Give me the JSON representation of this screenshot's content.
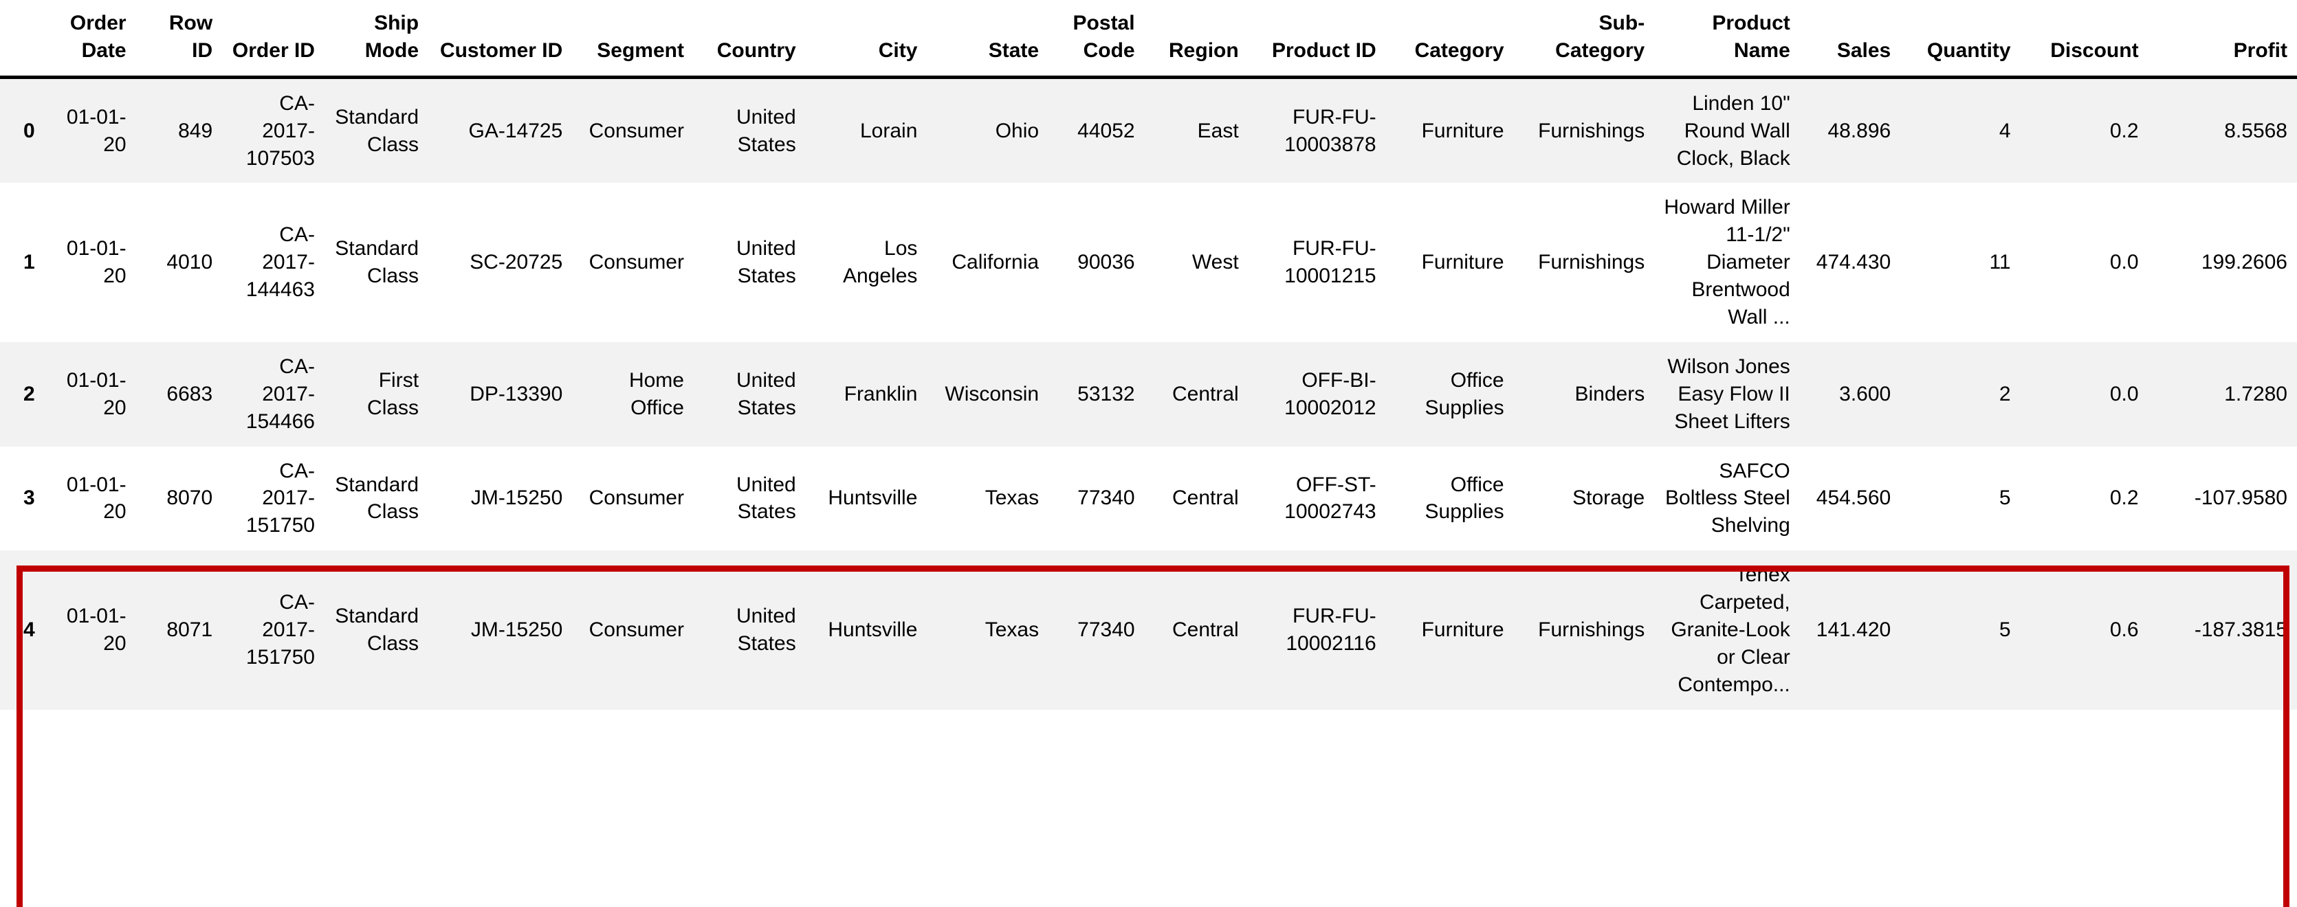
{
  "table": {
    "index_header": "",
    "columns": [
      "Order Date",
      "Row ID",
      "Order ID",
      "Ship Mode",
      "Customer ID",
      "Segment",
      "Country",
      "City",
      "State",
      "Postal Code",
      "Region",
      "Product ID",
      "Category",
      "Sub-Category",
      "Product Name",
      "Sales",
      "Quantity",
      "Discount",
      "Profit"
    ],
    "rows": [
      {
        "index": "0",
        "cells": [
          "01-01-20",
          "849",
          "CA-2017-107503",
          "Standard Class",
          "GA-14725",
          "Consumer",
          "United States",
          "Lorain",
          "Ohio",
          "44052",
          "East",
          "FUR-FU-10003878",
          "Furniture",
          "Furnishings",
          "Linden 10\" Round Wall Clock, Black",
          "48.896",
          "4",
          "0.2",
          "8.5568"
        ]
      },
      {
        "index": "1",
        "cells": [
          "01-01-20",
          "4010",
          "CA-2017-144463",
          "Standard Class",
          "SC-20725",
          "Consumer",
          "United States",
          "Los Angeles",
          "California",
          "90036",
          "West",
          "FUR-FU-10001215",
          "Furniture",
          "Furnishings",
          "Howard Miller 11-1/2\" Diameter Brentwood Wall ...",
          "474.430",
          "11",
          "0.0",
          "199.2606"
        ]
      },
      {
        "index": "2",
        "cells": [
          "01-01-20",
          "6683",
          "CA-2017-154466",
          "First Class",
          "DP-13390",
          "Home Office",
          "United States",
          "Franklin",
          "Wisconsin",
          "53132",
          "Central",
          "OFF-BI-10002012",
          "Office Supplies",
          "Binders",
          "Wilson Jones Easy Flow II Sheet Lifters",
          "3.600",
          "2",
          "0.0",
          "1.7280"
        ]
      },
      {
        "index": "3",
        "cells": [
          "01-01-20",
          "8070",
          "CA-2017-151750",
          "Standard Class",
          "JM-15250",
          "Consumer",
          "United States",
          "Huntsville",
          "Texas",
          "77340",
          "Central",
          "OFF-ST-10002743",
          "Office Supplies",
          "Storage",
          "SAFCO Boltless Steel Shelving",
          "454.560",
          "5",
          "0.2",
          "-107.9580"
        ]
      },
      {
        "index": "4",
        "cells": [
          "01-01-20",
          "8071",
          "CA-2017-151750",
          "Standard Class",
          "JM-15250",
          "Consumer",
          "United States",
          "Huntsville",
          "Texas",
          "77340",
          "Central",
          "FUR-FU-10002116",
          "Furniture",
          "Furnishings",
          "Tenex Carpeted, Granite-Look or Clear Contempo...",
          "141.420",
          "5",
          "0.6",
          "-187.3815"
        ]
      }
    ]
  },
  "annotation": {
    "highlight_color": "#c00000",
    "highlighted_row_indices": [
      "3",
      "4"
    ]
  },
  "style": {
    "stripe_color": "#f2f2f2",
    "base_color": "#ffffff",
    "text_color": "#000000",
    "header_rule_color": "#000000"
  }
}
